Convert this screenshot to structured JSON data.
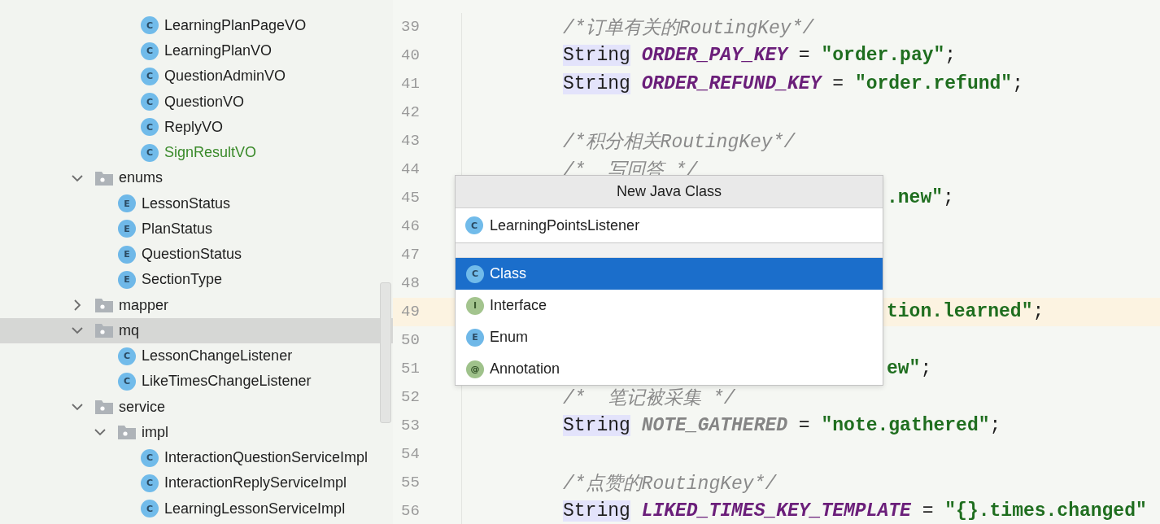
{
  "project_tree": {
    "clipped_branch": {
      "children": [
        {
          "label": "LearningPlanPageVO",
          "kind": "class",
          "icon_letter": "C",
          "added": false,
          "selected": false
        },
        {
          "label": "LearningPlanVO",
          "kind": "class",
          "icon_letter": "C",
          "added": false,
          "selected": false
        },
        {
          "label": "QuestionAdminVO",
          "kind": "class",
          "icon_letter": "C",
          "added": false,
          "selected": false
        },
        {
          "label": "QuestionVO",
          "kind": "class",
          "icon_letter": "C",
          "added": false,
          "selected": false
        },
        {
          "label": "ReplyVO",
          "kind": "class",
          "icon_letter": "C",
          "added": false,
          "selected": false
        },
        {
          "label": "SignResultVO",
          "kind": "class",
          "icon_letter": "C",
          "added": true,
          "selected": false
        }
      ]
    },
    "nodes": [
      {
        "label": "enums",
        "kind": "folder",
        "expanded": true,
        "selected": false,
        "children": [
          {
            "label": "LessonStatus",
            "kind": "enum",
            "icon_letter": "E",
            "added": false,
            "selected": false
          },
          {
            "label": "PlanStatus",
            "kind": "enum",
            "icon_letter": "E",
            "added": false,
            "selected": false
          },
          {
            "label": "QuestionStatus",
            "kind": "enum",
            "icon_letter": "E",
            "added": false,
            "selected": false
          },
          {
            "label": "SectionType",
            "kind": "enum",
            "icon_letter": "E",
            "added": false,
            "selected": false
          }
        ]
      },
      {
        "label": "mapper",
        "kind": "folder",
        "expanded": false,
        "selected": false
      },
      {
        "label": "mq",
        "kind": "folder",
        "expanded": true,
        "selected": true,
        "children": [
          {
            "label": "LessonChangeListener",
            "kind": "class",
            "icon_letter": "C",
            "added": false,
            "selected": false
          },
          {
            "label": "LikeTimesChangeListener",
            "kind": "class",
            "icon_letter": "C",
            "added": false,
            "selected": false
          }
        ]
      },
      {
        "label": "service",
        "kind": "folder",
        "expanded": true,
        "selected": false,
        "children": [
          {
            "label": "impl",
            "kind": "folder",
            "expanded": true,
            "selected": false,
            "children": [
              {
                "label": "InteractionQuestionServiceImpl",
                "kind": "class",
                "icon_letter": "C",
                "added": false,
                "selected": false
              },
              {
                "label": "InteractionReplyServiceImpl",
                "kind": "class",
                "icon_letter": "C",
                "added": false,
                "selected": false
              },
              {
                "label": "LearningLessonServiceImpl",
                "kind": "class",
                "icon_letter": "C",
                "added": false,
                "selected": false
              }
            ]
          }
        ]
      }
    ]
  },
  "editor": {
    "lines": [
      {
        "number": "39",
        "current": false,
        "kind": "code",
        "tokens": [
          {
            "kind": "comment",
            "text": "/*订单有关的RoutingKey*/"
          }
        ]
      },
      {
        "number": "40",
        "current": false,
        "kind": "code",
        "tokens": [
          {
            "kind": "type",
            "text": "String"
          },
          {
            "kind": "constant",
            "text": " ORDER_PAY_KEY"
          },
          {
            "kind": "plain",
            "text": " = "
          },
          {
            "kind": "string",
            "text": "\"order.pay\""
          },
          {
            "kind": "plain",
            "text": ";"
          }
        ]
      },
      {
        "number": "41",
        "current": false,
        "kind": "code",
        "tokens": [
          {
            "kind": "type",
            "text": "String"
          },
          {
            "kind": "constant",
            "text": " ORDER_REFUND_KEY"
          },
          {
            "kind": "plain",
            "text": " = "
          },
          {
            "kind": "string",
            "text": "\"order.refund\""
          },
          {
            "kind": "plain",
            "text": ";"
          }
        ]
      },
      {
        "number": "42",
        "current": false
      },
      {
        "number": "43",
        "current": false,
        "kind": "code",
        "tokens": [
          {
            "kind": "comment",
            "text": "/*积分相关RoutingKey*/"
          }
        ]
      },
      {
        "number": "44",
        "current": false,
        "kind": "code",
        "tokens": [
          {
            "kind": "comment",
            "text": "/*  写回答 */"
          }
        ]
      },
      {
        "number": "45",
        "current": false,
        "kind": "tail",
        "tokens": [
          {
            "kind": "string",
            "text": ".new\""
          },
          {
            "kind": "plain",
            "text": ";"
          }
        ]
      },
      {
        "number": "46",
        "current": false
      },
      {
        "number": "47",
        "current": false
      },
      {
        "number": "48",
        "current": false
      },
      {
        "number": "49",
        "current": true,
        "kind": "tail",
        "tokens": [
          {
            "kind": "string",
            "text": "tion.learned\""
          },
          {
            "kind": "plain",
            "text": ";"
          }
        ]
      },
      {
        "number": "50",
        "current": false
      },
      {
        "number": "51",
        "current": false,
        "kind": "tail",
        "tokens": [
          {
            "kind": "string",
            "text": "ew\""
          },
          {
            "kind": "plain",
            "text": ";"
          }
        ]
      },
      {
        "number": "52",
        "current": false,
        "kind": "code",
        "tokens": [
          {
            "kind": "comment",
            "text": "/*  笔记被采集 */"
          }
        ]
      },
      {
        "number": "53",
        "current": false,
        "kind": "code",
        "tokens": [
          {
            "kind": "type",
            "text": "String"
          },
          {
            "kind": "unused_constant",
            "text": " NOTE_GATHERED"
          },
          {
            "kind": "plain",
            "text": " = "
          },
          {
            "kind": "string",
            "text": "\"note.gathered\""
          },
          {
            "kind": "plain",
            "text": ";"
          }
        ]
      },
      {
        "number": "54",
        "current": false
      },
      {
        "number": "55",
        "current": false,
        "kind": "code",
        "tokens": [
          {
            "kind": "comment",
            "text": "/*点赞的RoutingKey*/"
          }
        ]
      },
      {
        "number": "56",
        "current": false,
        "kind": "code",
        "tokens": [
          {
            "kind": "type",
            "text": "String"
          },
          {
            "kind": "constant",
            "text": " LIKED_TIMES_KEY_TEMPLATE"
          },
          {
            "kind": "plain",
            "text": " = "
          },
          {
            "kind": "string",
            "text": "\"{}.times.changed\""
          }
        ]
      }
    ]
  },
  "dialog": {
    "title": "New Java Class",
    "name_field": {
      "icon_letter": "C",
      "value": "LearningPointsListener"
    },
    "kinds": [
      {
        "label": "Class",
        "kind": "class",
        "icon_letter": "C",
        "selected": true
      },
      {
        "label": "Interface",
        "kind": "interface",
        "icon_letter": "I",
        "selected": false
      },
      {
        "label": "Enum",
        "kind": "enum",
        "icon_letter": "E",
        "selected": false
      },
      {
        "label": "Annotation",
        "kind": "annotation",
        "icon_letter": "@",
        "selected": false
      }
    ]
  }
}
